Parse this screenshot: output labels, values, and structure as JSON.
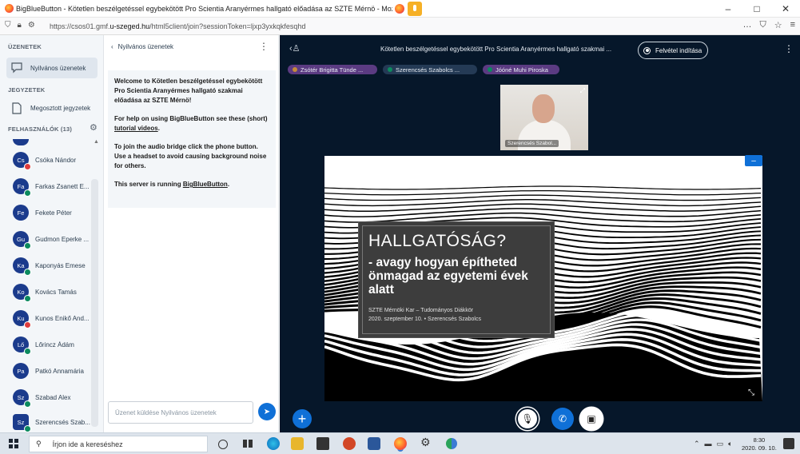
{
  "browser": {
    "window_title": "BigBlueButton - Kötetlen beszélgetéssel egybekötött Pro Scientia Aranyérmes hallgató előadása az SZTE Mérnö - Mozilla Firefox",
    "url_prefix": "https://csos01.gmf.",
    "url_domain": "u-szeged.hu",
    "url_suffix": "/html5client/join?sessionToken=ljxp3yxkqkfesqhd",
    "menu_icon": "…",
    "bookmark_icon": "☆",
    "hamburger_icon": "≡"
  },
  "sidebar": {
    "messages_header": "ÜZENETEK",
    "public_chat": "Nyilvános üzenetek",
    "notes_header": "JEGYZETEK",
    "shared_notes": "Megosztott jegyzetek",
    "users_header": "FELHASZNÁLÓK (13)",
    "users": [
      {
        "initials": "Cs",
        "name": "Csóka Nándor",
        "status": "red"
      },
      {
        "initials": "Fa",
        "name": "Farkas Zsanett E...",
        "status": "green"
      },
      {
        "initials": "Fe",
        "name": "Fekete Péter",
        "status": "none"
      },
      {
        "initials": "Gu",
        "name": "Gudmon Eperke ...",
        "status": "green"
      },
      {
        "initials": "Ka",
        "name": "Kaponyás Emese",
        "status": "green"
      },
      {
        "initials": "Ko",
        "name": "Kovács Tamás",
        "status": "green"
      },
      {
        "initials": "Ku",
        "name": "Kunos Enikő And...",
        "status": "red"
      },
      {
        "initials": "Lő",
        "name": "Lőrincz Ádám",
        "status": "green"
      },
      {
        "initials": "Pa",
        "name": "Patkó Annamária",
        "status": "none"
      },
      {
        "initials": "Sz",
        "name": "Szabad Alex",
        "status": "green"
      },
      {
        "initials": "Sz",
        "name": "Szerencsés Szab...",
        "status": "green"
      }
    ]
  },
  "chat": {
    "back_label": "Nyilvános üzenetek",
    "welcome_1": "Welcome to Kötetlen beszélgetéssel egybekötött Pro Scientia Aranyérmes hallgató szakmai előadása az SZTE Mérnö!",
    "welcome_2a": "For help on using BigBlueButton see these (short) ",
    "welcome_2b": "tutorial videos",
    "welcome_2c": ".",
    "welcome_3": "To join the audio bridge click the phone button. Use a headset to avoid causing background noise for others.",
    "welcome_4a": "This server is running ",
    "welcome_4b": "BigBlueButton",
    "welcome_4c": ".",
    "input_placeholder": "Üzenet küldése Nyilvános üzenetek"
  },
  "main": {
    "meeting_title": "Kötetlen beszélgetéssel egybekötött Pro Scientia Aranyérmes hallgató szakmai ...",
    "record_label": "Felvétel indítása",
    "talkers": [
      "Zsótér Brigitta Tünde ...",
      "Szerencsés Szabolcs ...",
      "Jóóné Muhi Piroska"
    ],
    "webcam_name": "Szerencsés Szabol...",
    "slide": {
      "heading": "HALLGATÓSÁG?",
      "subtitle": "- avagy hogyan építheted önmagad az egyetemi évek alatt",
      "footer_1": "SZTE Mérnöki Kar – Tudományos Diákkör",
      "footer_2": "2020. szeptember 10.   •   Szerencsés Szabolcs"
    }
  },
  "taskbar": {
    "search_placeholder": "Írjon ide a kereséshez",
    "time": "8:30",
    "date": "2020. 09. 10."
  }
}
